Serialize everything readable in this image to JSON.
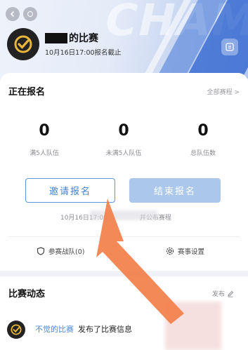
{
  "header": {
    "background_word": "CHAMPION",
    "title_suffix": "的比赛",
    "deadline": "10月16日17:00报名截止"
  },
  "registration": {
    "section_title": "正在报名",
    "all_events_link": "全部赛程 >",
    "stats": [
      {
        "value": "0",
        "label": "满5人队伍"
      },
      {
        "value": "0",
        "label": "未满5人队伍"
      },
      {
        "value": "0",
        "label": "总队伍数"
      }
    ],
    "invite_button": "邀请报名",
    "end_button": "结束报名",
    "note_prefix": "10月16日17:00",
    "note_suffix": "并公布赛程",
    "teams_link": "参赛战队(0)",
    "settings_link": "赛事设置"
  },
  "activity": {
    "section_title": "比赛动态",
    "publish_label": "发布",
    "feed": [
      {
        "author": "不觉的比赛",
        "text": "发布了比赛信息"
      }
    ]
  },
  "colors": {
    "accent_blue": "#3f83d1",
    "disabled_blue": "#abc8ec",
    "arrow_orange": "#f2804a"
  }
}
